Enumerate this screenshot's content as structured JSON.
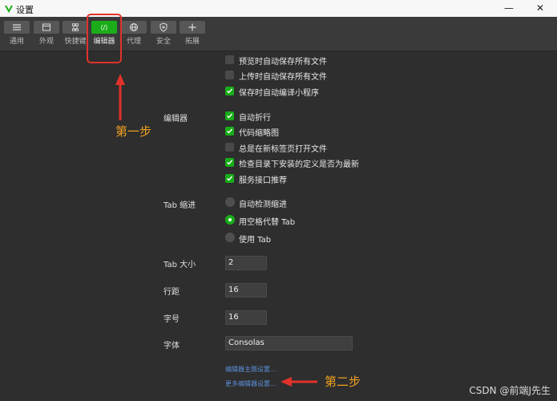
{
  "window": {
    "title": "设置",
    "minimize": "—",
    "close": "✕"
  },
  "toolbar": {
    "items": [
      {
        "label": "通用",
        "icon": "list-icon",
        "active": false
      },
      {
        "label": "外观",
        "icon": "window-icon",
        "active": false
      },
      {
        "label": "快捷键",
        "icon": "command-icon",
        "active": false
      },
      {
        "label": "编辑器",
        "icon": "code-icon",
        "active": true
      },
      {
        "label": "代理",
        "icon": "globe-icon",
        "active": false
      },
      {
        "label": "安全",
        "icon": "shield-icon",
        "active": false
      },
      {
        "label": "拓展",
        "icon": "plus-icon",
        "active": false
      }
    ],
    "code_glyph": "⟨/⟩"
  },
  "general_options": [
    {
      "label": "预览时自动保存所有文件",
      "checked": false
    },
    {
      "label": "上传时自动保存所有文件",
      "checked": false
    },
    {
      "label": "保存时自动编译小程序",
      "checked": true
    }
  ],
  "editor": {
    "section_label": "编辑器",
    "options": [
      {
        "label": "自动折行",
        "checked": true
      },
      {
        "label": "代码缩略图",
        "checked": true
      },
      {
        "label": "总是在新标签页打开文件",
        "checked": false
      },
      {
        "label": "检查目录下安装的定义是否为最新",
        "checked": true
      },
      {
        "label": "服务接口推荐",
        "checked": true
      }
    ]
  },
  "tab_indent": {
    "label": "Tab 缩进",
    "options": [
      {
        "label": "自动检测缩进",
        "selected": false
      },
      {
        "label": "用空格代替 Tab",
        "selected": true
      },
      {
        "label": "使用 Tab",
        "selected": false
      }
    ]
  },
  "tab_size": {
    "label": "Tab 大小",
    "value": "2"
  },
  "line_height": {
    "label": "行距",
    "value": "16"
  },
  "font_size": {
    "label": "字号",
    "value": "16"
  },
  "font_family": {
    "label": "字体",
    "value": "Consolas"
  },
  "links": {
    "theme": "编辑器主题设置...",
    "more": "更多编辑器设置..."
  },
  "annotations": {
    "step1": "第一步",
    "step2": "第二步",
    "color": "#f0a020",
    "arrow_color": "#e0322b"
  },
  "watermark": "CSDN @前端J先生",
  "colors": {
    "accent": "#1aad19",
    "background": "#2e2e2e",
    "link": "#5b8fd8"
  }
}
